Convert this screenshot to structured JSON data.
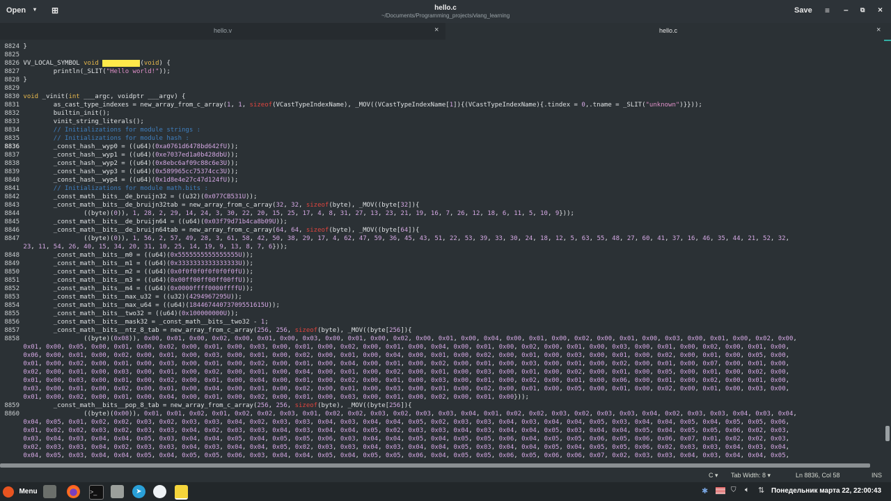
{
  "header": {
    "open_label": "Open",
    "title": "hello.c",
    "subtitle": "~/Documents/Programming_projects/vlang_learning",
    "save_label": "Save"
  },
  "tabs": [
    {
      "label": "hello.v",
      "active": false
    },
    {
      "label": "hello.c",
      "active": true
    }
  ],
  "editor_lines": [
    {
      "n": "8824",
      "t": "}"
    },
    {
      "n": "8825",
      "t": ""
    },
    {
      "n": "8826",
      "t": "VV_LOCAL_SYMBOL void main__main(void) {"
    },
    {
      "n": "8827",
      "t": "        println(_SLIT(\"Hello world!\"));"
    },
    {
      "n": "8828",
      "t": "}"
    },
    {
      "n": "8829",
      "t": ""
    },
    {
      "n": "8830",
      "t": "void _vinit(int ___argc, voidptr ___argv) {"
    },
    {
      "n": "8831",
      "t": "        as_cast_type_indexes = new_array_from_c_array(1, 1, sizeof(VCastTypeIndexName), _MOV((VCastTypeIndexName[1]){(VCastTypeIndexName){.tindex = 0,.tname = _SLIT(\"unknown\")}}));"
    },
    {
      "n": "8832",
      "t": "        builtin_init();"
    },
    {
      "n": "8833",
      "t": "        vinit_string_literals();"
    },
    {
      "n": "8834",
      "t": "        // Initializations for module strings :"
    },
    {
      "n": "8835",
      "t": "        // Initializations for module hash :"
    },
    {
      "n": "8836",
      "t": "        _const_hash__wyp0 = ((u64)(0xa0761d6478bd642fU));"
    },
    {
      "n": "8837",
      "t": "        _const_hash__wyp1 = ((u64)(0xe7037ed1a0b428dbU));"
    },
    {
      "n": "8838",
      "t": "        _const_hash__wyp2 = ((u64)(0x8ebc6af09c88c6e3U));"
    },
    {
      "n": "8839",
      "t": "        _const_hash__wyp3 = ((u64)(0x589965cc75374cc3U));"
    },
    {
      "n": "8840",
      "t": "        _const_hash__wyp4 = ((u64)(0x1d8e4e27c47d124fU));"
    },
    {
      "n": "8841",
      "t": "        // Initializations for module math.bits :"
    },
    {
      "n": "8842",
      "t": "        _const_math__bits__de_bruijn32 = ((u32)(0x077CB531U));"
    },
    {
      "n": "8843",
      "t": "        _const_math__bits__de_bruijn32tab = new_array_from_c_array(32, 32, sizeof(byte), _MOV((byte[32]){"
    },
    {
      "n": "8844",
      "t": "                ((byte)(0)), 1, 28, 2, 29, 14, 24, 3, 30, 22, 20, 15, 25, 17, 4, 8, 31, 27, 13, 23, 21, 19, 16, 7, 26, 12, 18, 6, 11, 5, 10, 9}));"
    },
    {
      "n": "8845",
      "t": "        _const_math__bits__de_bruijn64 = ((u64)(0x03f79d71b4ca8b09U));"
    },
    {
      "n": "8846",
      "t": "        _const_math__bits__de_bruijn64tab = new_array_from_c_array(64, 64, sizeof(byte), _MOV((byte[64]){"
    },
    {
      "n": "8847",
      "t": "                ((byte)(0)), 1, 56, 2, 57, 49, 28, 3, 61, 58, 42, 50, 38, 29, 17, 4, 62, 47, 59, 36, 45, 43, 51, 22, 53, 39, 33, 30, 24, 18, 12, 5, 63, 55, 48, 27, 60, 41, 37, 16, 46, 35, 44, 21, 52, 32,"
    },
    {
      "n": "",
      "t": "23, 11, 54, 26, 40, 15, 34, 20, 31, 10, 25, 14, 19, 9, 13, 8, 7, 6}));"
    },
    {
      "n": "8848",
      "t": "        _const_math__bits__m0 = ((u64)(0x5555555555555555U));"
    },
    {
      "n": "8849",
      "t": "        _const_math__bits__m1 = ((u64)(0x3333333333333333U));"
    },
    {
      "n": "8850",
      "t": "        _const_math__bits__m2 = ((u64)(0x0f0f0f0f0f0f0f0fU));"
    },
    {
      "n": "8851",
      "t": "        _const_math__bits__m3 = ((u64)(0x00ff00ff00ff00ffU));"
    },
    {
      "n": "8852",
      "t": "        _const_math__bits__m4 = ((u64)(0x0000ffff0000ffffU));"
    },
    {
      "n": "8853",
      "t": "        _const_math__bits__max_u32 = ((u32)(4294967295U));"
    },
    {
      "n": "8854",
      "t": "        _const_math__bits__max_u64 = ((u64)(18446744073709551615U));"
    },
    {
      "n": "8855",
      "t": "        _const_math__bits__two32 = ((u64)(0x100000000U));"
    },
    {
      "n": "8856",
      "t": "        _const_math__bits__mask32 = _const_math__bits__two32 - 1;"
    },
    {
      "n": "8857",
      "t": "        _const_math__bits__ntz_8_tab = new_array_from_c_array(256, 256, sizeof(byte), _MOV((byte[256]){"
    },
    {
      "n": "8858",
      "t": "                ((byte)(0x08)), 0x00, 0x01, 0x00, 0x02, 0x00, 0x01, 0x00, 0x03, 0x00, 0x01, 0x00, 0x02, 0x00, 0x01, 0x00, 0x04, 0x00, 0x01, 0x00, 0x02, 0x00, 0x01, 0x00, 0x03, 0x00, 0x01, 0x00, 0x02, 0x00,"
    },
    {
      "n": "",
      "t": "0x01, 0x00, 0x05, 0x00, 0x01, 0x00, 0x02, 0x00, 0x01, 0x00, 0x03, 0x00, 0x01, 0x00, 0x02, 0x00, 0x01, 0x00, 0x04, 0x00, 0x01, 0x00, 0x02, 0x00, 0x01, 0x00, 0x03, 0x00, 0x01, 0x00, 0x02, 0x00, 0x01, 0x00,"
    },
    {
      "n": "",
      "t": "0x06, 0x00, 0x01, 0x00, 0x02, 0x00, 0x01, 0x00, 0x03, 0x00, 0x01, 0x00, 0x02, 0x00, 0x01, 0x00, 0x04, 0x00, 0x01, 0x00, 0x02, 0x00, 0x01, 0x00, 0x03, 0x00, 0x01, 0x00, 0x02, 0x00, 0x01, 0x00, 0x05, 0x00,"
    },
    {
      "n": "",
      "t": "0x01, 0x00, 0x02, 0x00, 0x01, 0x00, 0x03, 0x00, 0x01, 0x00, 0x02, 0x00, 0x01, 0x00, 0x04, 0x00, 0x01, 0x00, 0x02, 0x00, 0x01, 0x00, 0x03, 0x00, 0x01, 0x00, 0x02, 0x00, 0x01, 0x00, 0x07, 0x00, 0x01, 0x00,"
    },
    {
      "n": "",
      "t": "0x02, 0x00, 0x01, 0x00, 0x03, 0x00, 0x01, 0x00, 0x02, 0x00, 0x01, 0x00, 0x04, 0x00, 0x01, 0x00, 0x02, 0x00, 0x01, 0x00, 0x03, 0x00, 0x01, 0x00, 0x02, 0x00, 0x01, 0x00, 0x05, 0x00, 0x01, 0x00, 0x02, 0x00,"
    },
    {
      "n": "",
      "t": "0x01, 0x00, 0x03, 0x00, 0x01, 0x00, 0x02, 0x00, 0x01, 0x00, 0x04, 0x00, 0x01, 0x00, 0x02, 0x00, 0x01, 0x00, 0x03, 0x00, 0x01, 0x00, 0x02, 0x00, 0x01, 0x00, 0x06, 0x00, 0x01, 0x00, 0x02, 0x00, 0x01, 0x00,"
    },
    {
      "n": "",
      "t": "0x03, 0x00, 0x01, 0x00, 0x02, 0x00, 0x01, 0x00, 0x04, 0x00, 0x01, 0x00, 0x02, 0x00, 0x01, 0x00, 0x03, 0x00, 0x01, 0x00, 0x02, 0x00, 0x01, 0x00, 0x05, 0x00, 0x01, 0x00, 0x02, 0x00, 0x01, 0x00, 0x03, 0x00,"
    },
    {
      "n": "",
      "t": "0x01, 0x00, 0x02, 0x00, 0x01, 0x00, 0x04, 0x00, 0x01, 0x00, 0x02, 0x00, 0x01, 0x00, 0x03, 0x00, 0x01, 0x00, 0x02, 0x00, 0x01, 0x00}));"
    },
    {
      "n": "8859",
      "t": "        _const_math__bits__pop_8_tab = new_array_from_c_array(256, 256, sizeof(byte), _MOV((byte[256]){"
    },
    {
      "n": "8860",
      "t": "                ((byte)(0x00)), 0x01, 0x01, 0x02, 0x01, 0x02, 0x02, 0x03, 0x01, 0x02, 0x02, 0x03, 0x02, 0x03, 0x03, 0x04, 0x01, 0x02, 0x02, 0x03, 0x02, 0x03, 0x03, 0x04, 0x02, 0x03, 0x03, 0x04, 0x03, 0x04,"
    },
    {
      "n": "",
      "t": "0x04, 0x05, 0x01, 0x02, 0x02, 0x03, 0x02, 0x03, 0x03, 0x04, 0x02, 0x03, 0x03, 0x04, 0x03, 0x04, 0x04, 0x05, 0x02, 0x03, 0x03, 0x04, 0x03, 0x04, 0x04, 0x05, 0x03, 0x04, 0x04, 0x05, 0x04, 0x05, 0x05, 0x06,"
    },
    {
      "n": "",
      "t": "0x01, 0x02, 0x02, 0x03, 0x02, 0x03, 0x03, 0x04, 0x02, 0x03, 0x03, 0x04, 0x03, 0x04, 0x04, 0x05, 0x02, 0x03, 0x03, 0x04, 0x03, 0x04, 0x04, 0x05, 0x03, 0x04, 0x04, 0x05, 0x04, 0x05, 0x05, 0x06, 0x02, 0x03,"
    },
    {
      "n": "",
      "t": "0x03, 0x04, 0x03, 0x04, 0x04, 0x05, 0x03, 0x04, 0x04, 0x05, 0x04, 0x05, 0x05, 0x06, 0x03, 0x04, 0x04, 0x05, 0x04, 0x05, 0x05, 0x06, 0x04, 0x05, 0x05, 0x06, 0x05, 0x06, 0x06, 0x07, 0x01, 0x02, 0x02, 0x03,"
    },
    {
      "n": "",
      "t": "0x02, 0x03, 0x03, 0x04, 0x02, 0x03, 0x03, 0x04, 0x03, 0x04, 0x04, 0x05, 0x02, 0x03, 0x03, 0x04, 0x03, 0x04, 0x04, 0x05, 0x03, 0x04, 0x04, 0x05, 0x04, 0x05, 0x05, 0x06, 0x02, 0x03, 0x03, 0x04, 0x03, 0x04,"
    },
    {
      "n": "",
      "t": "0x04, 0x05, 0x03, 0x04, 0x04, 0x05, 0x04, 0x05, 0x05, 0x06, 0x03, 0x04, 0x04, 0x05, 0x04, 0x05, 0x05, 0x06, 0x04, 0x05, 0x05, 0x06, 0x05, 0x06, 0x06, 0x07, 0x02, 0x03, 0x03, 0x04, 0x03, 0x04, 0x04, 0x05,"
    }
  ],
  "statusbar": {
    "language": "C",
    "tab_width": "Tab Width: 8",
    "position": "Ln 8836, Col 58",
    "mode": "INS"
  },
  "taskbar": {
    "menu_label": "Menu",
    "clock": "Понедельник марта 22, 22:00:43"
  },
  "colors": {
    "accent": "#33b0a5",
    "keyword": "#e7b84c",
    "string": "#dd8fc7",
    "number": "#d5a8e4",
    "comment": "#3f7fbf",
    "sizeof": "#e0453f",
    "highlight": "#ffe94a"
  }
}
